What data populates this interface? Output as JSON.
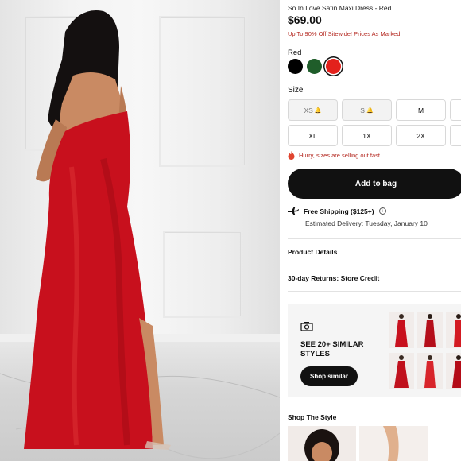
{
  "product": {
    "name": "So In Love Satin Maxi Dress - Red",
    "price": "$69.00",
    "promo": "Up To 90% Off Sitewide! Prices As Marked"
  },
  "colors": {
    "label": "Red",
    "swatches": [
      {
        "name": "black",
        "hex": "#000000",
        "selected": false
      },
      {
        "name": "green",
        "hex": "#1f5d2a",
        "selected": false
      },
      {
        "name": "red",
        "hex": "#e3211c",
        "selected": true
      }
    ]
  },
  "sizes": {
    "label": "Size",
    "options": [
      {
        "label": "XS",
        "notify": true
      },
      {
        "label": "S",
        "notify": true
      },
      {
        "label": "M",
        "notify": false
      },
      {
        "label": "XL",
        "notify": false
      },
      {
        "label": "1X",
        "notify": false
      },
      {
        "label": "2X",
        "notify": false
      }
    ]
  },
  "stock_alert": "Hurry, sizes are selling out fast...",
  "add_to_bag": "Add to bag",
  "shipping": {
    "title": "Free Shipping ($125+)",
    "eta": "Estimated Delivery: Tuesday, January 10"
  },
  "details_links": {
    "product_details": "Product Details",
    "returns": "30-day Returns: Store Credit"
  },
  "similar": {
    "title": "SEE 20+ SIMILAR STYLES",
    "button": "Shop similar"
  },
  "shop_the_style": "Shop The Style",
  "theme": {
    "accent": "#111111",
    "alert": "#b3261e",
    "dress": "#c8101d"
  }
}
